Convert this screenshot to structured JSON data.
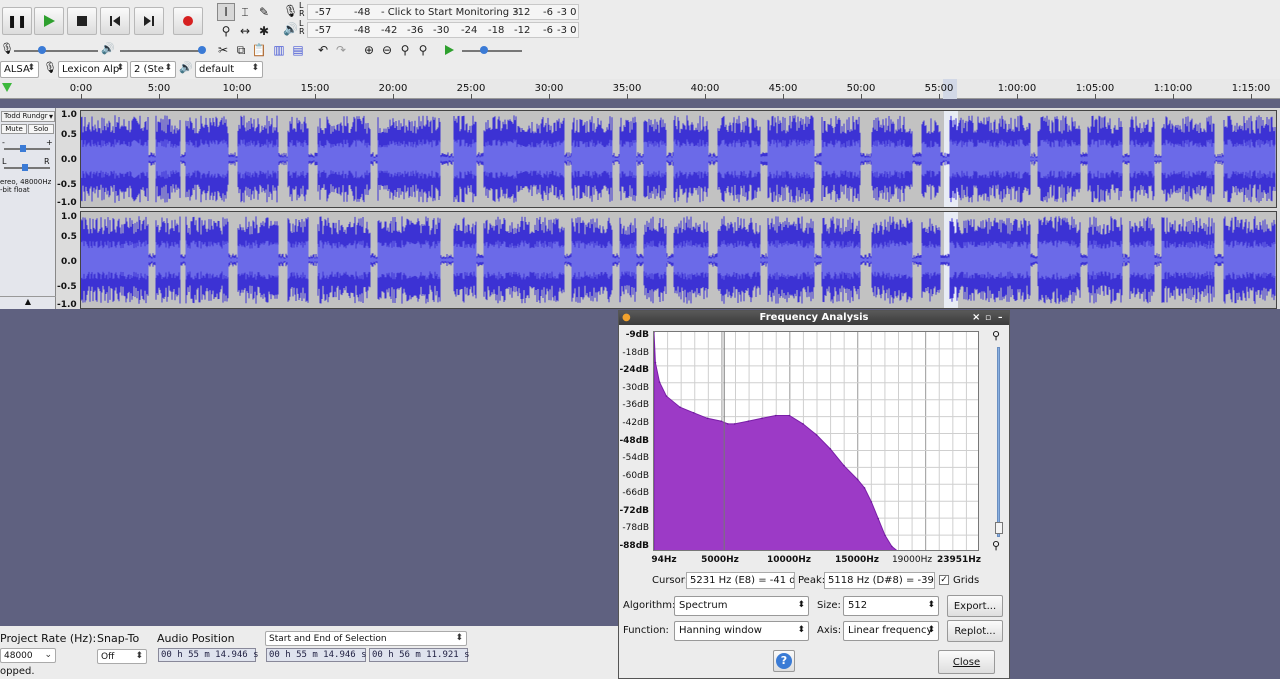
{
  "transport": {
    "pause_icon": "pause-icon",
    "play_icon": "play-icon",
    "stop_icon": "stop-icon",
    "skip_start_icon": "skip-start-icon",
    "skip_end_icon": "skip-end-icon",
    "record_icon": "record-icon",
    "play_color": "#2ea02e",
    "record_color": "#d62020"
  },
  "meters": {
    "record_ticks": [
      "-57",
      "-48",
      "- Click to Start Monitoring 3",
      "-12",
      "-6",
      "-3 0"
    ],
    "play_ticks": [
      "-57",
      "-48",
      "-42",
      "-36",
      "-30",
      "-24",
      "-18",
      "-12",
      "-6",
      "-3 0"
    ],
    "lr_top": "L R",
    "lr_bottom": "L R"
  },
  "device": {
    "host": "ALSA",
    "input": "Lexicon Alp",
    "channels": "2 (Ste",
    "output": "default"
  },
  "ruler": {
    "labels": [
      "0:00",
      "5:00",
      "10:00",
      "15:00",
      "20:00",
      "25:00",
      "30:00",
      "35:00",
      "40:00",
      "45:00",
      "50:00",
      "55:00",
      "1:00:00",
      "1:05:00",
      "1:10:00",
      "1:15:00"
    ]
  },
  "track": {
    "name": "Todd Rundgr",
    "mute": "Mute",
    "solo": "Solo",
    "gain_minus": "-",
    "gain_plus": "+",
    "pan_l": "L",
    "pan_r": "R",
    "info_1": "ereo, 48000Hz",
    "info_2": "-bit float",
    "scale": [
      "1.0",
      "0.5",
      "0.0",
      "-0.5",
      "-1.0"
    ],
    "wave_color": "#3c32d4",
    "wave_rms_color": "#6b6ae8"
  },
  "status": {
    "rate_label": "Project Rate (Hz):",
    "rate_value": "48000",
    "snap_label": "Snap-To",
    "snap_value": "Off",
    "position_label": "Audio Position",
    "position_value": "00 h 55 m 14.946 s",
    "selection_mode": "Start and End of Selection",
    "sel_start": "00 h 55 m 14.946 s",
    "sel_end": "00 h 56 m 11.921 s",
    "message": "opped."
  },
  "dialog": {
    "title": "Frequency Analysis",
    "cursor_label": "Cursor:",
    "cursor_value": "5231 Hz (E8) = -41 dB",
    "peak_label": "Peak:",
    "peak_value": "5118 Hz (D#8) = -39.7",
    "grids_label": "Grids",
    "grids_checked": true,
    "algorithm_label": "Algorithm:",
    "algorithm_value": "Spectrum",
    "size_label": "Size:",
    "size_value": "512",
    "export_label": "Export...",
    "function_label": "Function:",
    "function_value": "Hanning window",
    "axis_label": "Axis:",
    "axis_value": "Linear frequency",
    "replot_label": "Replot...",
    "help_label": "?",
    "close_label": "Close",
    "fill_color": "#9c3ac6"
  },
  "chart_data": {
    "type": "area",
    "y_tick_labels": [
      "-9dB",
      "-18dB",
      "-24dB",
      "-30dB",
      "-36dB",
      "-42dB",
      "-48dB",
      "-54dB",
      "-60dB",
      "-66dB",
      "-72dB",
      "-78dB",
      "-88dB"
    ],
    "x_tick_labels": [
      "94Hz",
      "5000Hz",
      "10000Hz",
      "15000Hz",
      "19000Hz",
      "23951Hz"
    ],
    "xlim": [
      94,
      23951
    ],
    "ylim": [
      -88,
      -9
    ],
    "grid": true,
    "x": [
      94,
      200,
      500,
      1000,
      2000,
      3000,
      4000,
      5000,
      5500,
      6000,
      7000,
      8000,
      9000,
      10000,
      11000,
      12000,
      13000,
      14000,
      15000,
      15500,
      16000,
      16500,
      17000,
      17500,
      18000
    ],
    "y": [
      -9,
      -20,
      -27,
      -32,
      -36,
      -38,
      -40,
      -41,
      -42,
      -42,
      -41,
      -40,
      -39,
      -39,
      -42,
      -46,
      -51,
      -57,
      -62,
      -65,
      -70,
      -76,
      -82,
      -86,
      -88
    ]
  }
}
